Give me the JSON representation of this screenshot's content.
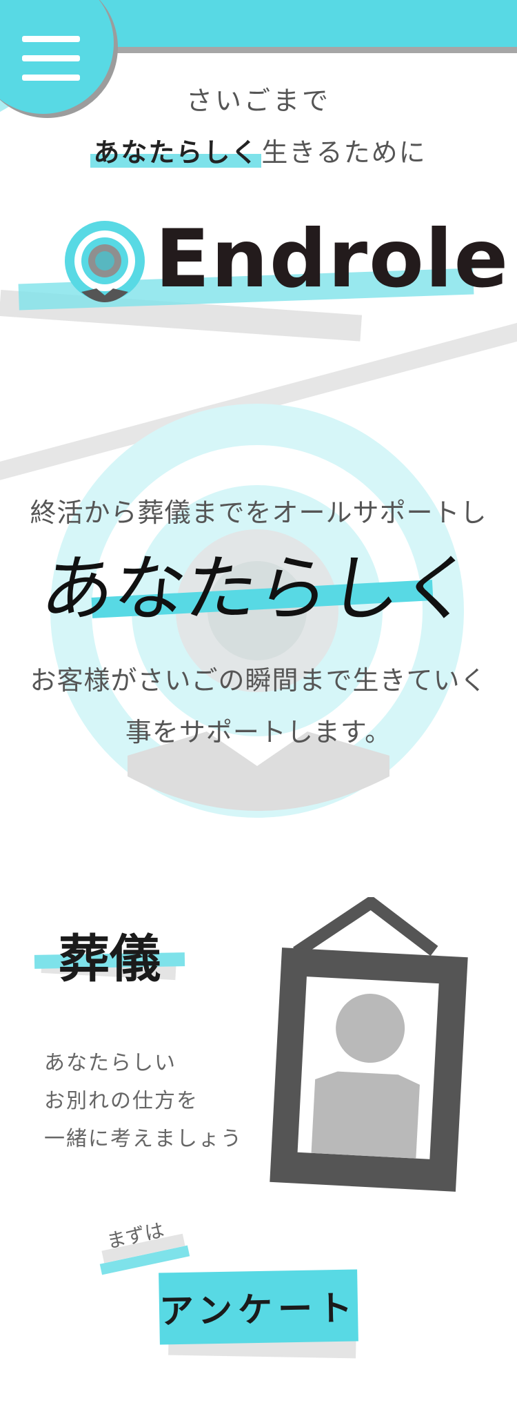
{
  "header": {
    "menu_icon": "hamburger-icon"
  },
  "tagline": {
    "line1": "さいごまで",
    "emphasis": "あなたらしく",
    "rest": "生きるために"
  },
  "logo": {
    "text": "Endrole",
    "icon": "target-pin-icon"
  },
  "hero": {
    "line1": "終活から葬儀までをオールサポートし",
    "highlight": "あなたらしく",
    "line2": "お客様がさいごの瞬間まで生きていく",
    "line3": "事をサポートします。"
  },
  "funeral_section": {
    "title": "葬儀",
    "desc_line1": "あなたらしい",
    "desc_line2": "お別れの仕方を",
    "desc_line3": "一緒に考えましょう",
    "image": "portrait-frame-icon"
  },
  "cta": {
    "pre_label": "まずは",
    "button_label": "アンケート"
  },
  "colors": {
    "accent": "#58d9e4",
    "accent_light": "#7ee2ea",
    "gray": "#e6e6e6",
    "dark": "#231b1c"
  }
}
